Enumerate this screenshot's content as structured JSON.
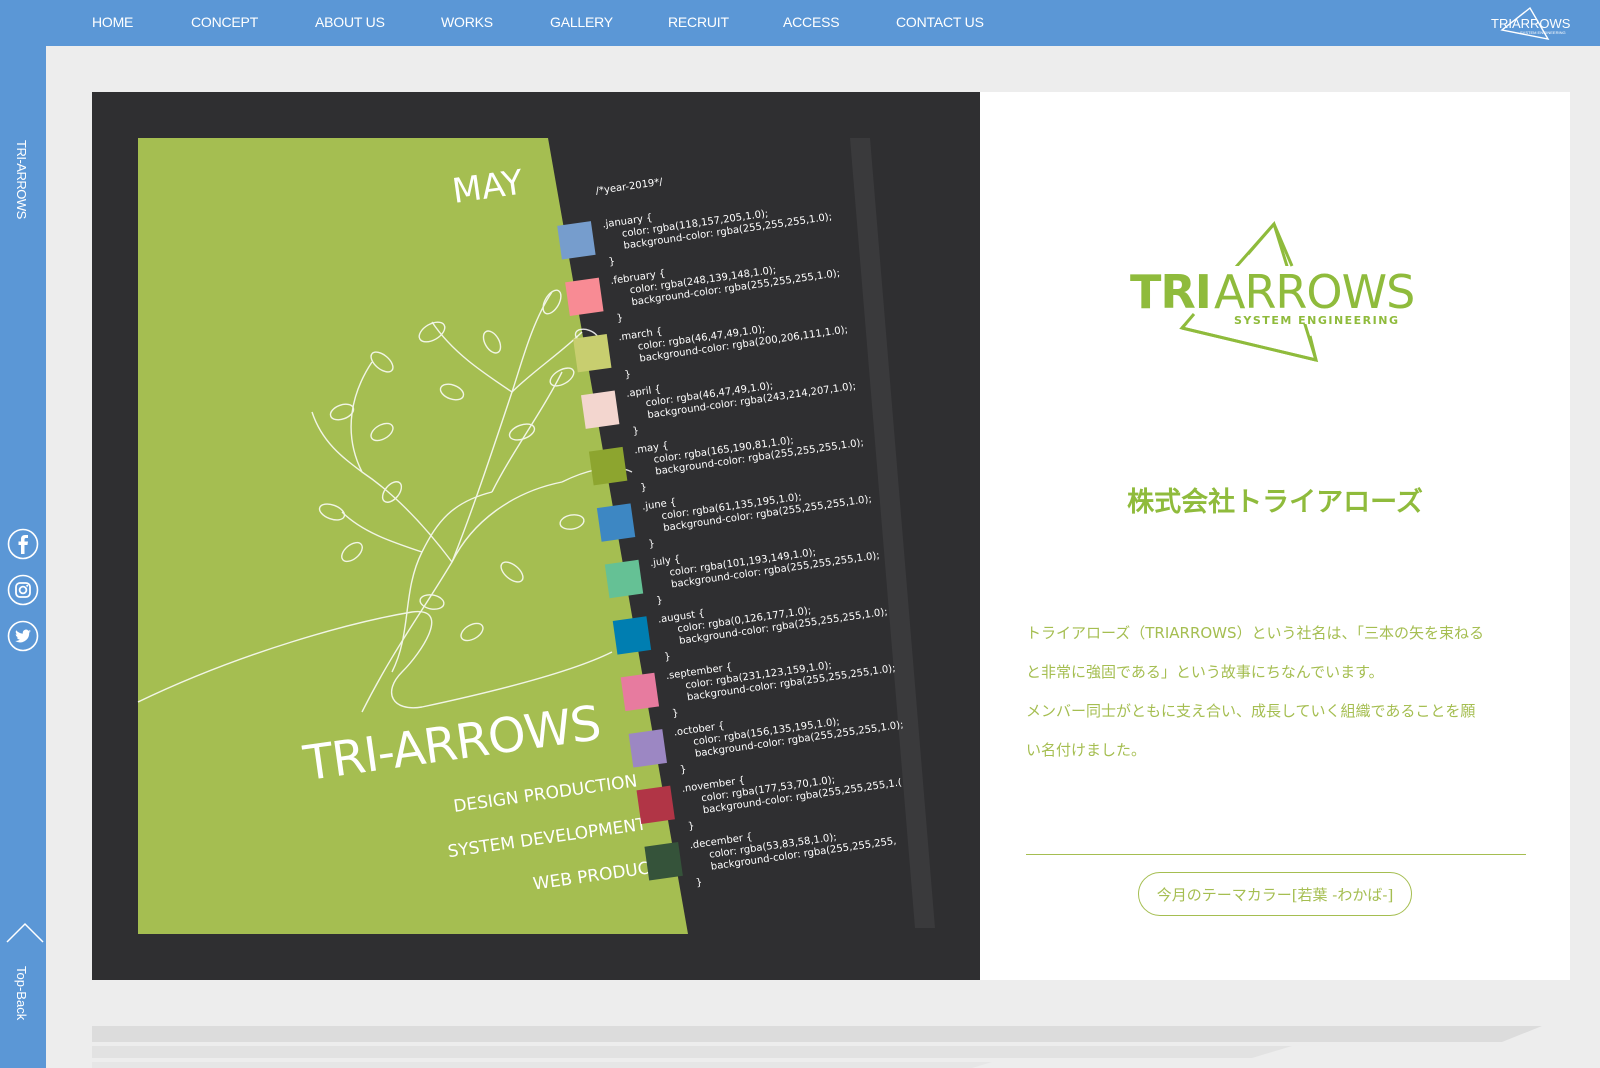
{
  "nav": {
    "items": [
      {
        "label": "HOME"
      },
      {
        "label": "CONCEPT"
      },
      {
        "label": "ABOUT US"
      },
      {
        "label": "WORKS"
      },
      {
        "label": "GALLERY"
      },
      {
        "label": "RECRUIT"
      },
      {
        "label": "ACCESS"
      },
      {
        "label": "CONTACT US"
      }
    ],
    "logo_text": "TRIARROWS",
    "logo_sub": "SYSTEM ENGINEERING"
  },
  "sidebar": {
    "brand": "TRI-ARROWS",
    "social": [
      {
        "icon": "facebook-icon",
        "glyph": "f"
      },
      {
        "icon": "instagram-icon",
        "glyph": ""
      },
      {
        "icon": "twitter-icon",
        "glyph": ""
      }
    ],
    "topback": "Top-Back"
  },
  "poster": {
    "month": "MAY",
    "title": "TRI-ARROWS",
    "services": [
      "DESIGN PRODUCTION",
      "SYSTEM DEVELOPMENT",
      "WEB PRODUCT"
    ],
    "code_header": "/*year-2019*/",
    "months": [
      {
        "name": ".january {",
        "color": "color: rgba(118,157,205,1.0);",
        "bg": "background-color: rgba(255,255,255,1.0);",
        "swatch": "#769dcd"
      },
      {
        "name": ".february {",
        "color": "color: rgba(248,139,148,1.0);",
        "bg": "background-color: rgba(255,255,255,1.0);",
        "swatch": "#f88b94"
      },
      {
        "name": ".march {",
        "color": "color: rgba(46,47,49,1.0);",
        "bg": "background-color: rgba(200,206,111,1.0);",
        "swatch": "#c8ce6f"
      },
      {
        "name": ".april {",
        "color": "color: rgba(46,47,49,1.0);",
        "bg": "background-color: rgba(243,214,207,1.0);",
        "swatch": "#f3d6cf"
      },
      {
        "name": ".may {",
        "color": "color: rgba(165,190,81,1.0);",
        "bg": "background-color: rgba(255,255,255,1.0);",
        "swatch": "#8da52f"
      },
      {
        "name": ".june {",
        "color": "color: rgba(61,135,195,1.0);",
        "bg": "background-color: rgba(255,255,255,1.0);",
        "swatch": "#3d87c3"
      },
      {
        "name": ".july {",
        "color": "color: rgba(101,193,149,1.0);",
        "bg": "background-color: rgba(255,255,255,1.0);",
        "swatch": "#65c195"
      },
      {
        "name": ".august {",
        "color": "color: rgba(0,126,177,1.0);",
        "bg": "background-color: rgba(255,255,255,1.0);",
        "swatch": "#007eb1"
      },
      {
        "name": ".september {",
        "color": "color: rgba(231,123,159,1.0);",
        "bg": "background-color: rgba(255,255,255,1.0);",
        "swatch": "#e77b9f"
      },
      {
        "name": ".october {",
        "color": "color: rgba(156,135,195,1.0);",
        "bg": "background-color: rgba(255,255,255,1.0);",
        "swatch": "#9c87c3"
      },
      {
        "name": ".november {",
        "color": "color: rgba(177,53,70,1.0);",
        "bg": "background-color: rgba(255,255,255,1.(",
        "swatch": "#b13546"
      },
      {
        "name": ".december {",
        "color": "color: rgba(53,83,58,1.0);",
        "bg": "background-color: rgba(255,255,255,",
        "swatch": "#35533a"
      }
    ],
    "close": "}"
  },
  "info": {
    "logo_main_bold": "TRI",
    "logo_main_light": "ARROWS",
    "logo_sub": "SYSTEM ENGINEERING",
    "company": "株式会社トライアローズ",
    "description": [
      "トライアローズ（TRIARROWS）という社名は、「三本の矢を束ねる",
      "と非常に強固である」という故事にちなんでいます。",
      "メンバー同士がともに支え合い、成長していく組織であることを願",
      "い名付けました。"
    ],
    "theme_button": "今月のテーマカラー[若葉 -わかば-]"
  },
  "colors": {
    "nav": "#5b97d6",
    "green": "#a5be51",
    "poster_bg": "#2f2f31"
  }
}
